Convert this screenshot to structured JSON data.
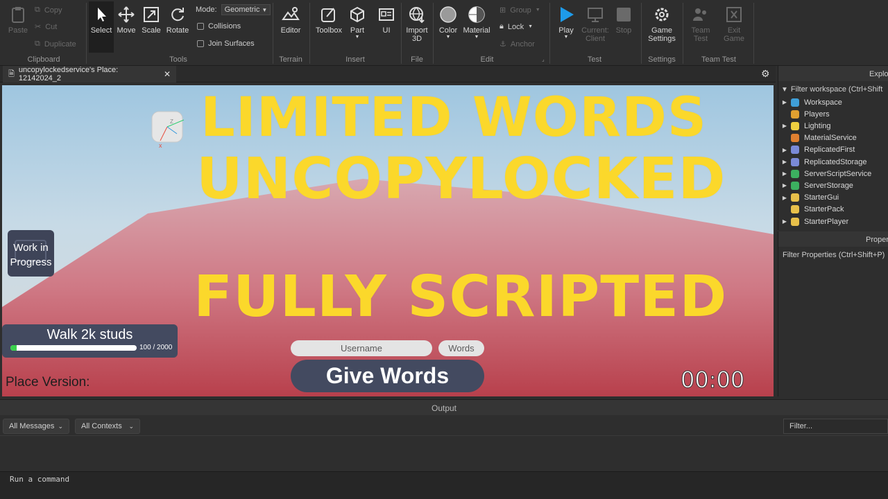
{
  "ribbon": {
    "clipboard": {
      "paste": "Paste",
      "copy": "Copy",
      "cut": "Cut",
      "duplicate": "Duplicate",
      "label": "Clipboard"
    },
    "tools": {
      "select": "Select",
      "move": "Move",
      "scale": "Scale",
      "rotate": "Rotate",
      "mode_label": "Mode:",
      "mode_value": "Geometric",
      "collisions": "Collisions",
      "join_surfaces": "Join Surfaces",
      "label": "Tools"
    },
    "terrain": {
      "editor": "Editor",
      "label": "Terrain"
    },
    "insert": {
      "toolbox": "Toolbox",
      "part": "Part",
      "ui": "UI",
      "label": "Insert"
    },
    "file": {
      "import": "Import",
      "import2": "3D",
      "label": "File"
    },
    "edit": {
      "color": "Color",
      "material": "Material",
      "group": "Group",
      "lock": "Lock",
      "anchor": "Anchor",
      "label": "Edit"
    },
    "test": {
      "play": "Play",
      "current": "Current:",
      "client": "Client",
      "stop": "Stop",
      "label": "Test"
    },
    "settings": {
      "game": "Game",
      "settings": "Settings",
      "label": "Settings"
    },
    "team_test": {
      "team": "Team",
      "test": "Test",
      "exit": "Exit",
      "game": "Game",
      "label": "Team Test"
    }
  },
  "tab": {
    "title": "uncopylockedservice's Place: 12142024_2"
  },
  "viewport": {
    "headline1": "LIMITED WORDS",
    "headline2": "UNCOPYLOCKED",
    "headline3": "FULLY SCRIPTED",
    "wip1": "Work in",
    "wip2": "Progress",
    "quest_title": "Walk 2k studs",
    "quest_progress": "100 / 2000",
    "quest_fraction": 0.05,
    "username_placeholder": "Username",
    "words_placeholder": "Words",
    "give_button": "Give Words",
    "place_version": "Place Version:",
    "timer": "00:00",
    "gizmo_z": "Z",
    "gizmo_x": "x"
  },
  "explorer": {
    "title": "Explo",
    "filter": "Filter workspace (Ctrl+Shift",
    "items": [
      {
        "label": "Workspace",
        "color": "#3f9fd8"
      },
      {
        "label": "Players",
        "color": "#e0a030"
      },
      {
        "label": "Lighting",
        "color": "#f0d040"
      },
      {
        "label": "MaterialService",
        "color": "#e08030"
      },
      {
        "label": "ReplicatedFirst",
        "color": "#7a8ad8"
      },
      {
        "label": "ReplicatedStorage",
        "color": "#7a8ad8"
      },
      {
        "label": "ServerScriptService",
        "color": "#3cb060"
      },
      {
        "label": "ServerStorage",
        "color": "#3cb060"
      },
      {
        "label": "StarterGui",
        "color": "#e8c04a"
      },
      {
        "label": "StarterPack",
        "color": "#e8c04a"
      },
      {
        "label": "StarterPlayer",
        "color": "#e8c04a"
      }
    ]
  },
  "properties": {
    "title": "Proper",
    "filter": "Filter Properties (Ctrl+Shift+P)"
  },
  "output": {
    "title": "Output",
    "messages": "All Messages",
    "contexts": "All Contexts",
    "filter": "Filter...",
    "command": "Run a command"
  },
  "colors": {
    "accent_yellow": "#fbd82b",
    "play_blue": "#1e9bea",
    "panel": "#434a60"
  }
}
